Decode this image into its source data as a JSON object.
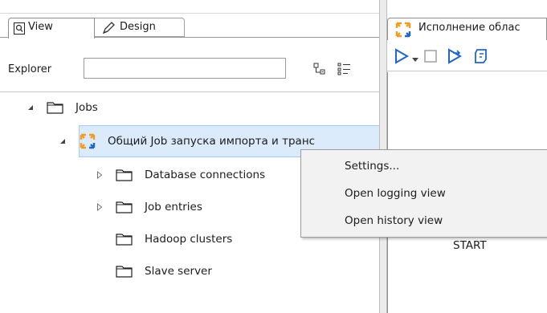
{
  "left_panel": {
    "tabs": [
      {
        "label": "View",
        "icon": "view-icon",
        "active": true
      },
      {
        "label": "Design",
        "icon": "pencil-icon",
        "active": false
      }
    ],
    "explorer": {
      "label": "Explorer",
      "search_value": "",
      "toolbar_icons": [
        "collapse-tree-icon",
        "expand-list-icon"
      ]
    },
    "tree": [
      {
        "label": "Jobs",
        "icon": "folder-icon",
        "expander": "expanded"
      },
      {
        "label": "Общий Job запуска импорта и транс",
        "icon": "job-icon",
        "expander": "expanded",
        "selected": true
      },
      {
        "label": "Database connections",
        "icon": "folder-icon",
        "expander": "collapsed"
      },
      {
        "label": "Job entries",
        "icon": "folder-icon",
        "expander": "collapsed"
      },
      {
        "label": "Hadoop clusters",
        "icon": "folder-icon",
        "expander": "none"
      },
      {
        "label": "Slave server",
        "icon": "folder-icon",
        "expander": "none"
      }
    ]
  },
  "right_panel": {
    "tab_label": "Исполнение облас",
    "tab_icon": "job-icon",
    "toolbar_icons": [
      "run-icon",
      "run-dropdown-icon",
      "stop-icon",
      "run-step-icon",
      "script-icon"
    ],
    "canvas_text": "START"
  },
  "context_menu": {
    "items": [
      "Settings...",
      "Open logging view",
      "Open history view"
    ]
  },
  "colors": {
    "selection_bg": "#dcebfb",
    "selection_border": "#a9cbef",
    "job_icon_orange": "#f39c1f",
    "toolbar_blue": "#1f66c8"
  }
}
